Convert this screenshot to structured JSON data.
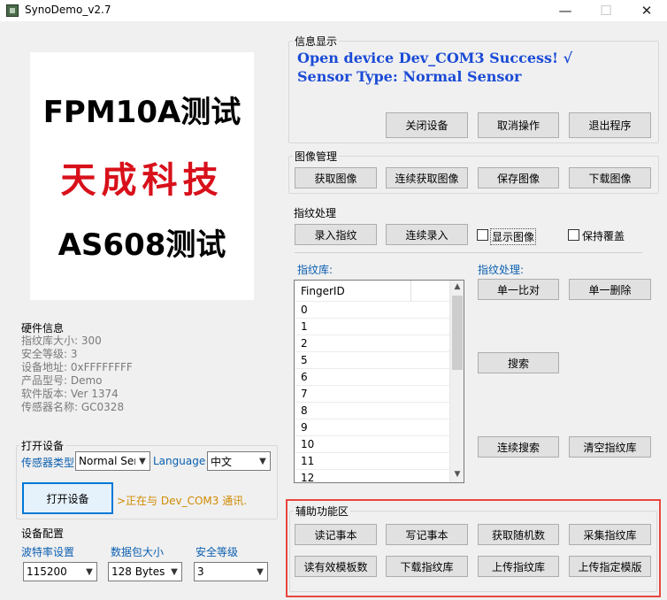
{
  "window": {
    "title": "SynoDemo_v2.7",
    "minimize_glyph": "—",
    "maximize_glyph": "☐",
    "close_glyph": "✕",
    "icon": "app-icon"
  },
  "logo": {
    "line1": "FPM10A测试",
    "line2": "天成科技",
    "line3": "AS608测试"
  },
  "hardware": {
    "title": "硬件信息",
    "lines": [
      "指纹库大小: 300",
      "安全等级: 3",
      "设备地址: 0xFFFFFFFF",
      "产品型号:  Demo",
      "软件版本: Ver 1374",
      "传感器名称: GC0328"
    ]
  },
  "open_device": {
    "title": "打开设备",
    "sensor_type_label": "传感器类型",
    "sensor_type_value": "Normal Ser",
    "language_label": "Language",
    "language_value": "中文",
    "open_button": "打开设备",
    "status": ">正在与 Dev_COM3 通讯."
  },
  "device_config": {
    "title": "设备配置",
    "baud_label": "波特率设置",
    "baud_value": "115200",
    "packet_label": "数据包大小",
    "packet_value": "128 Bytes",
    "security_label": "安全等级",
    "security_value": "3"
  },
  "info": {
    "title": "信息显示",
    "line1": "Open device Dev_COM3 Success! √",
    "line2": "Sensor Type: Normal Sensor",
    "buttons": [
      "关闭设备",
      "取消操作",
      "退出程序"
    ]
  },
  "image_mgmt": {
    "title": "图像管理",
    "buttons": [
      "获取图像",
      "连续获取图像",
      "保存图像",
      "下载图像"
    ]
  },
  "fingerprint": {
    "title": "指纹处理",
    "enroll": "录入指纹",
    "continuous_enroll": "连续录入",
    "show_image": "显示图像",
    "keep_overwrite": "保持覆盖",
    "library_label": "指纹库:",
    "list_header": "FingerID",
    "list_items": [
      "0",
      "1",
      "2",
      "5",
      "6",
      "7",
      "8",
      "9",
      "10",
      "11",
      "12"
    ],
    "process_label": "指纹处理:",
    "single_compare": "单一比对",
    "single_delete": "单一删除",
    "search": "搜索",
    "continuous_search": "连续搜索",
    "clear_library": "清空指纹库"
  },
  "aux": {
    "title": "辅助功能区",
    "row1": [
      "读记事本",
      "写记事本",
      "获取随机数",
      "采集指纹库"
    ],
    "row2": [
      "读有效模板数",
      "下载指纹库",
      "上传指纹库",
      "上传指定模版"
    ]
  },
  "colors": {
    "accent_blue": "#1b4bd6",
    "label_blue": "#0b5fb0",
    "status_orange": "#d08a00",
    "highlight_red": "#e8473f"
  }
}
